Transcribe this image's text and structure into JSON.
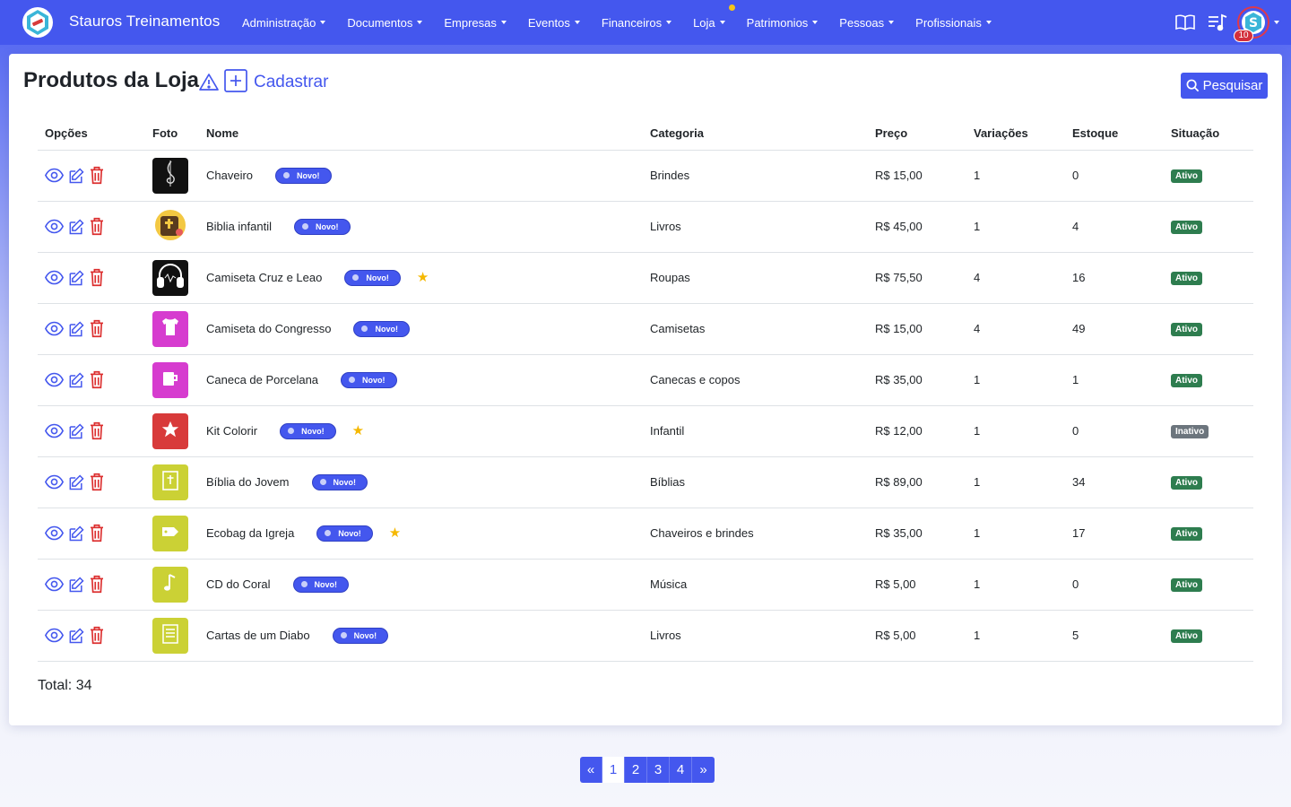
{
  "brand": {
    "name": "Stauros Treinamentos"
  },
  "nav": {
    "items": [
      {
        "label": "Administração"
      },
      {
        "label": "Documentos"
      },
      {
        "label": "Empresas"
      },
      {
        "label": "Eventos"
      },
      {
        "label": "Financeiros"
      },
      {
        "label": "Loja"
      },
      {
        "label": "Patrimonios"
      },
      {
        "label": "Pessoas"
      },
      {
        "label": "Profissionais"
      }
    ],
    "icons": [
      "book-icon",
      "playlist-icon"
    ],
    "notification_count": "10"
  },
  "page": {
    "title": "Produtos da Loja",
    "add_label": "Cadastrar",
    "search_label": "Pesquisar",
    "total_label": "Total: 34"
  },
  "table": {
    "headers": {
      "opcoes": "Opções",
      "foto": "Foto",
      "nome": "Nome",
      "categoria": "Categoria",
      "preco": "Preço",
      "variacoes": "Variações",
      "estoque": "Estoque",
      "situacao": "Situação"
    },
    "badge_label": "Novo!",
    "rows": [
      {
        "nome": "Chaveiro",
        "categoria": "Brindes",
        "preco": "R$ 15,00",
        "variacoes": "1",
        "estoque": "0",
        "situacao": "Ativo",
        "star": false,
        "thumb": "#111111",
        "icon": "clef-icon"
      },
      {
        "nome": "Biblia infantil",
        "categoria": "Livros",
        "preco": "R$ 45,00",
        "variacoes": "1",
        "estoque": "4",
        "situacao": "Ativo",
        "star": false,
        "thumb": "#ffffff",
        "icon": "bible-cartoon-icon"
      },
      {
        "nome": "Camiseta Cruz e Leao",
        "categoria": "Roupas",
        "preco": "R$ 75,50",
        "variacoes": "4",
        "estoque": "16",
        "situacao": "Ativo",
        "star": true,
        "thumb": "#111111",
        "icon": "headphones-icon"
      },
      {
        "nome": "Camiseta do Congresso",
        "categoria": "Camisetas",
        "preco": "R$ 15,00",
        "variacoes": "4",
        "estoque": "49",
        "situacao": "Ativo",
        "star": false,
        "thumb": "#d63ccf",
        "icon": "tshirt-icon"
      },
      {
        "nome": "Caneca de Porcelana",
        "categoria": "Canecas e copos",
        "preco": "R$ 35,00",
        "variacoes": "1",
        "estoque": "1",
        "situacao": "Ativo",
        "star": false,
        "thumb": "#d63ccf",
        "icon": "mug-icon"
      },
      {
        "nome": "Kit Colorir",
        "categoria": "Infantil",
        "preco": "R$ 12,00",
        "variacoes": "1",
        "estoque": "0",
        "situacao": "Inativo",
        "star": true,
        "thumb": "#d83a3a",
        "icon": "star-icon"
      },
      {
        "nome": "Bíblia do Jovem",
        "categoria": "Bíblias",
        "preco": "R$ 89,00",
        "variacoes": "1",
        "estoque": "34",
        "situacao": "Ativo",
        "star": false,
        "thumb": "#cbd135",
        "icon": "book-cross-icon"
      },
      {
        "nome": "Ecobag da Igreja",
        "categoria": "Chaveiros e brindes",
        "preco": "R$ 35,00",
        "variacoes": "1",
        "estoque": "17",
        "situacao": "Ativo",
        "star": true,
        "thumb": "#cbd135",
        "icon": "tag-icon"
      },
      {
        "nome": "CD do Coral",
        "categoria": "Música",
        "preco": "R$ 5,00",
        "variacoes": "1",
        "estoque": "0",
        "situacao": "Ativo",
        "star": false,
        "thumb": "#cbd135",
        "icon": "music-note-icon"
      },
      {
        "nome": "Cartas de um Diabo",
        "categoria": "Livros",
        "preco": "R$ 5,00",
        "variacoes": "1",
        "estoque": "5",
        "situacao": "Ativo",
        "star": false,
        "thumb": "#cbd135",
        "icon": "document-icon"
      }
    ]
  },
  "pagination": {
    "prev": "«",
    "pages": [
      "1",
      "2",
      "3",
      "4"
    ],
    "current": "1",
    "next": "»"
  },
  "colors": {
    "primary": "#4457ee",
    "danger": "#dc2f2f",
    "success": "#2e7d4f",
    "muted": "#6c757d",
    "star": "#f5b800"
  }
}
